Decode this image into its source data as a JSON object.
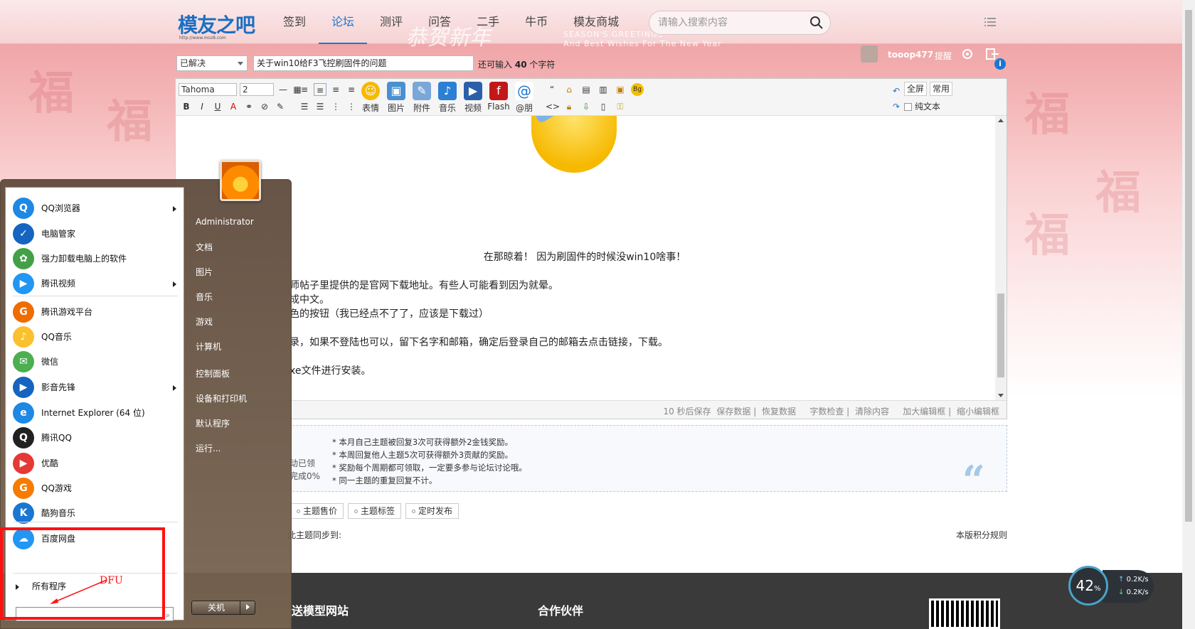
{
  "nav": {
    "logo_text": "模友之吧",
    "logo_url": "http://www.moz8.com",
    "items": [
      "签到",
      "论坛",
      "测评",
      "问答",
      "二手",
      "牛币",
      "模友商城"
    ],
    "active_index": 1,
    "search_placeholder": "请输入搜索内容",
    "greeting": "恭贺新年",
    "season": "SEASON'S GREETINGS",
    "season_sub": "And Best Wishes For The New Year"
  },
  "user": {
    "name": "tooop477",
    "tip_label": "提醒"
  },
  "post": {
    "status_value": "已解决",
    "title_value": "关于win10给F3飞控刷固件的问题",
    "hint_prefix": "还可输入",
    "hint_count": "40",
    "hint_suffix": "个字符"
  },
  "toolbar": {
    "font": "Tahoma",
    "size": "2",
    "big_buttons": [
      "表情",
      "图片",
      "附件",
      "音乐",
      "视频",
      "Flash",
      "@朋"
    ],
    "fullscreen": "全屏",
    "common": "常用",
    "plain_text": "纯文本"
  },
  "editor": {
    "center_line": "在那晾着！  因为刷固件的时候没win10啥事！",
    "lines": [
      "师帖子里提供的是官网下载地址。有些人可能看到因为就晕。",
      "成中文。",
      "色的按钮（我已经点不了了，应该是下载过）",
      "录，如果不登陆也可以，留下名字和邮箱，确定后登录自己的邮箱去点击链接，下载。",
      "xe文件进行安装。"
    ],
    "status_links": [
      "10 秒后保存",
      "保存数据",
      "恢复数据",
      "字数检查",
      "清除内容",
      "加大编辑框",
      "缩小编辑框"
    ]
  },
  "reward": {
    "lines": [
      "* 本月自己主题被回复3次可获得额外2金钱奖励。",
      "* 本周回复他人主题5次可获得额外3贡献的奖励。",
      "* 奖励每个周期都可领取，一定要多参与论坛讨论哦。",
      "* 同一主题的重复回复不计。"
    ],
    "ghost1": "动已领",
    "ghost2": "完成0%"
  },
  "options": {
    "tabs": [
      "主题售价",
      "主题标签",
      "定时发布"
    ],
    "sync_text": "此主题同步到:",
    "rule_text": "本版积分规则"
  },
  "footer": {
    "t1": "送模型网站",
    "t2": "合作伙伴"
  },
  "speed": {
    "percent": "42",
    "percent_unit": "%",
    "up": "0.2K/s",
    "down": "0.2K/s"
  },
  "start_menu": {
    "programs": [
      {
        "label": "QQ浏览器",
        "has_sub": true,
        "color": "#1e88e5",
        "glyph": "Q"
      },
      {
        "label": "电脑管家",
        "has_sub": false,
        "color": "#1565c0",
        "glyph": "✓"
      },
      {
        "label": "强力卸载电脑上的软件",
        "has_sub": false,
        "color": "#43a047",
        "glyph": "✿"
      },
      {
        "label": "腾讯视频",
        "has_sub": true,
        "color": "#2196f3",
        "glyph": "▶"
      },
      {
        "label": "腾讯游戏平台",
        "has_sub": false,
        "color": "#ef6c00",
        "glyph": "G"
      },
      {
        "label": "QQ音乐",
        "has_sub": false,
        "color": "#fbc02d",
        "glyph": "♪"
      },
      {
        "label": "微信",
        "has_sub": false,
        "color": "#4caf50",
        "glyph": "✉"
      },
      {
        "label": "影音先锋",
        "has_sub": true,
        "color": "#1565c0",
        "glyph": "▶"
      },
      {
        "label": "Internet Explorer (64 位)",
        "has_sub": false,
        "color": "#1e88e5",
        "glyph": "e"
      },
      {
        "label": "腾讯QQ",
        "has_sub": false,
        "color": "#212121",
        "glyph": "Q"
      },
      {
        "label": "优酷",
        "has_sub": false,
        "color": "#e53935",
        "glyph": "▶"
      },
      {
        "label": "QQ游戏",
        "has_sub": false,
        "color": "#f57c00",
        "glyph": "G"
      },
      {
        "label": "酷狗音乐",
        "has_sub": false,
        "color": "#1976d2",
        "glyph": "K"
      },
      {
        "label": "百度网盘",
        "has_sub": false,
        "color": "#2196f3",
        "glyph": "☁"
      }
    ],
    "all_programs": "所有程序",
    "right_links": [
      "Administrator",
      "文档",
      "图片",
      "音乐",
      "游戏",
      "计算机",
      "控制面板",
      "设备和打印机",
      "默认程序",
      "运行..."
    ],
    "shutdown": "关机"
  },
  "annotation": {
    "label": "DFU",
    "color": "#ff1111"
  }
}
